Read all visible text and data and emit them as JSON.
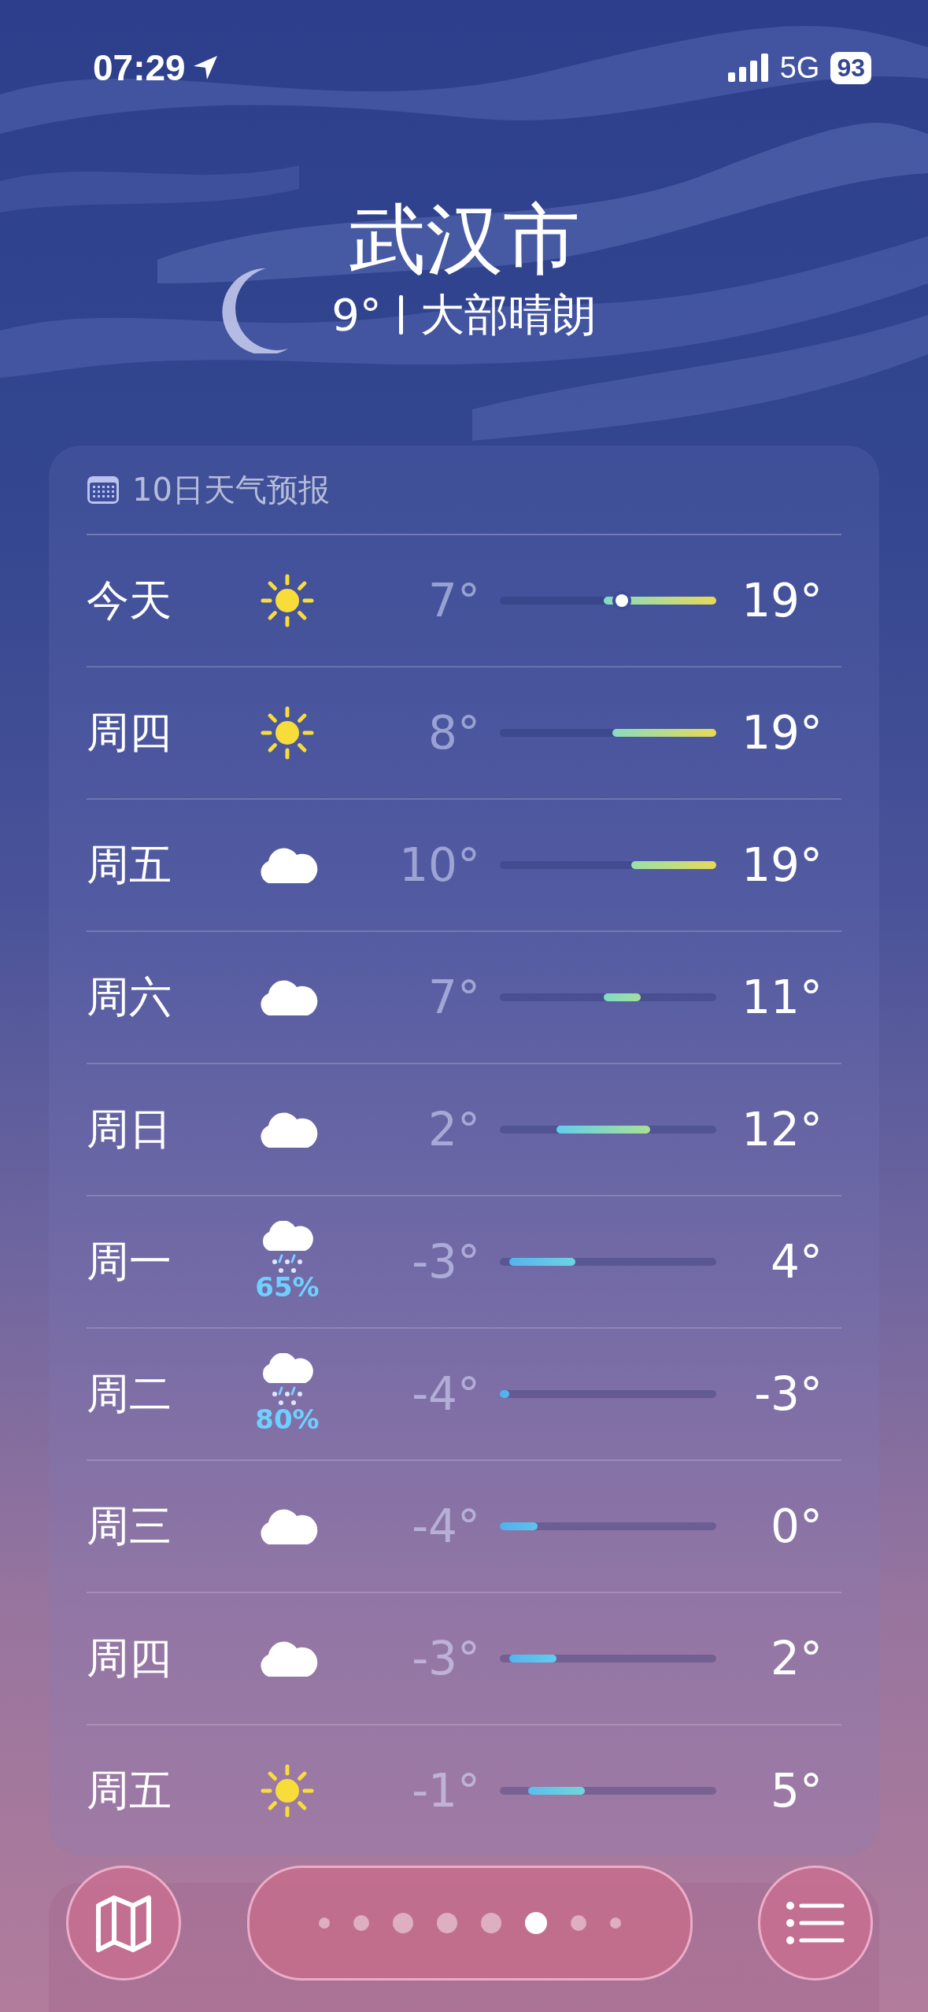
{
  "status_bar": {
    "time": "07:29",
    "network": "5G",
    "battery": "93"
  },
  "location": {
    "city": "武汉市",
    "temperature": "9°",
    "condition": "大部晴朗"
  },
  "forecast": {
    "title": "10日天气预报",
    "days": [
      {
        "day": "今天",
        "kind": "sun",
        "low": "7°",
        "high": "19°",
        "current": true
      },
      {
        "day": "周四",
        "kind": "sun",
        "low": "8°",
        "high": "19°",
        "current": false
      },
      {
        "day": "周五",
        "kind": "cloud",
        "low": "10°",
        "high": "19°",
        "current": false
      },
      {
        "day": "周六",
        "kind": "cloud",
        "low": "7°",
        "high": "11°",
        "current": false
      },
      {
        "day": "周日",
        "kind": "cloud",
        "low": "2°",
        "high": "12°",
        "current": false
      },
      {
        "day": "周一",
        "kind": "snow",
        "chance": "65%",
        "low": "-3°",
        "high": "4°",
        "current": false
      },
      {
        "day": "周二",
        "kind": "snow",
        "chance": "80%",
        "low": "-4°",
        "high": "-3°",
        "current": false
      },
      {
        "day": "周三",
        "kind": "cloud",
        "low": "-4°",
        "high": "0°",
        "current": false
      },
      {
        "day": "周四",
        "kind": "cloud",
        "low": "-3°",
        "high": "2°",
        "current": false
      },
      {
        "day": "周五",
        "kind": "sun",
        "low": "-1°",
        "high": "5°",
        "current": false
      }
    ]
  },
  "pages": [
    {
      "selected": false
    },
    {
      "selected": false
    },
    {
      "selected": false
    },
    {
      "selected": false
    },
    {
      "selected": false
    },
    {
      "selected": true
    },
    {
      "selected": false
    },
    {
      "selected": false
    }
  ]
}
